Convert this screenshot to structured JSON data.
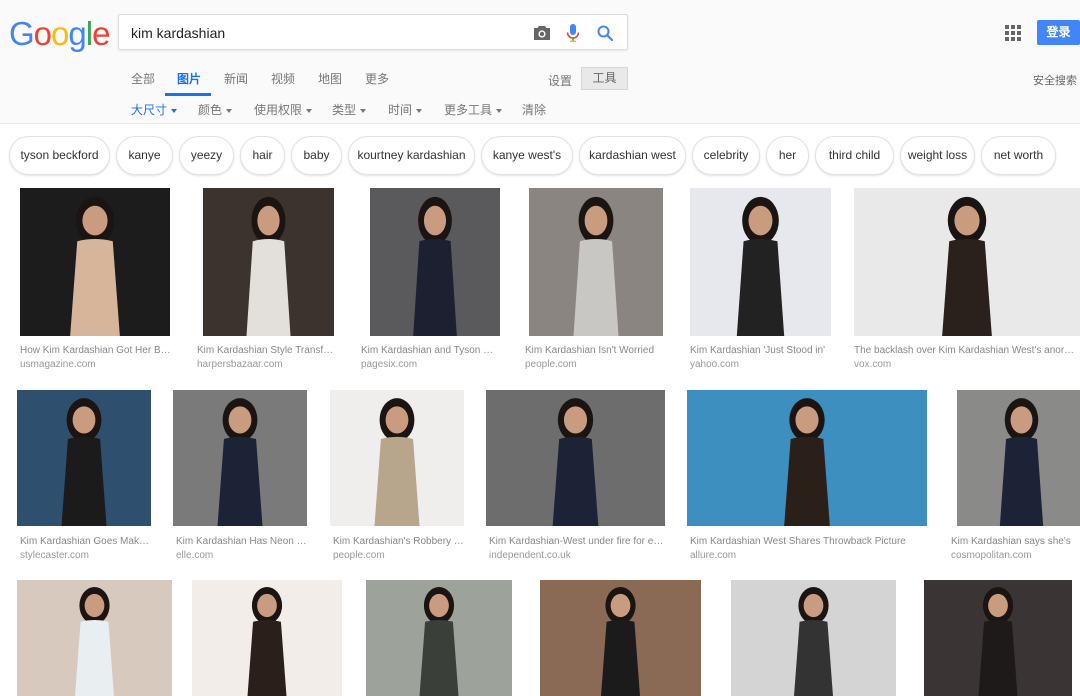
{
  "logo": {
    "text": "Google",
    "letters": [
      {
        "ch": "G",
        "color": "#4285f4"
      },
      {
        "ch": "o",
        "color": "#ea4335"
      },
      {
        "ch": "o",
        "color": "#fbbc05"
      },
      {
        "ch": "g",
        "color": "#4285f4"
      },
      {
        "ch": "l",
        "color": "#34a853"
      },
      {
        "ch": "e",
        "color": "#ea4335"
      }
    ]
  },
  "search": {
    "query": "kim kardashian",
    "camera_icon": "camera-icon",
    "mic_icon": "microphone-icon",
    "search_icon": "search-icon"
  },
  "header": {
    "apps_icon": "apps-grid-icon",
    "login_label": "登录",
    "settings_label": "设置",
    "tools_label": "工具",
    "safe_search_label": "安全搜索"
  },
  "tabs": [
    {
      "label": "全部",
      "active": false
    },
    {
      "label": "图片",
      "active": true
    },
    {
      "label": "新闻",
      "active": false
    },
    {
      "label": "视频",
      "active": false
    },
    {
      "label": "地图",
      "active": false
    },
    {
      "label": "更多",
      "active": false
    }
  ],
  "filters": [
    {
      "label": "大尺寸",
      "active": true,
      "dropdown": true
    },
    {
      "label": "颜色",
      "active": false,
      "dropdown": true
    },
    {
      "label": "使用权限",
      "active": false,
      "dropdown": true
    },
    {
      "label": "类型",
      "active": false,
      "dropdown": true
    },
    {
      "label": "时间",
      "active": false,
      "dropdown": true
    },
    {
      "label": "更多工具",
      "active": false,
      "dropdown": true
    },
    {
      "label": "清除",
      "active": false,
      "dropdown": false
    }
  ],
  "chips": [
    "tyson beckford",
    "kanye",
    "yeezy",
    "hair",
    "baby",
    "kourtney kardashian",
    "kanye west's",
    "kardashian west",
    "celebrity",
    "her",
    "third child",
    "weight loss",
    "net worth"
  ],
  "results": [
    {
      "title": "How Kim Kardashian Got Her Body Back",
      "source": "usmagazine.com",
      "bg": "#1c1c1c",
      "fg": "#d7b59a"
    },
    {
      "title": "Kim Kardashian Style Transformation",
      "source": "harpersbazaar.com",
      "bg": "#3b342e",
      "fg": "#e3e0dc"
    },
    {
      "title": "Kim Kardashian and Tyson Beckford",
      "source": "pagesix.com",
      "bg": "#5a5a5c",
      "fg": "#1d2030"
    },
    {
      "title": "Kim Kardashian Isn't Worried",
      "source": "people.com",
      "bg": "#8a8580",
      "fg": "#c9c7c4"
    },
    {
      "title": "Kim Kardashian 'Just Stood in'",
      "source": "yahoo.com",
      "bg": "#e6e8ee",
      "fg": "#222222"
    },
    {
      "title": "The backlash over Kim Kardashian West's anorexic photo",
      "source": "vox.com",
      "bg": "#e9e9e9",
      "fg": "#2a201c"
    },
    {
      "title": "Kim Kardashian Goes Makeup-Free",
      "source": "stylecaster.com",
      "bg": "#2f4f6f",
      "fg": "#1b1b1b"
    },
    {
      "title": "Kim Kardashian Has Neon Hair",
      "source": "elle.com",
      "bg": "#7a7a7a",
      "fg": "#1d2336"
    },
    {
      "title": "Kim Kardashian's Robbery Trial",
      "source": "people.com",
      "bg": "#efeeec",
      "fg": "#b8a68c"
    },
    {
      "title": "Kim Kardashian-West under fire for editing",
      "source": "independent.co.uk",
      "bg": "#6d6d6d",
      "fg": "#1d2336"
    },
    {
      "title": "Kim Kardashian West Shares Throwback Picture",
      "source": "allure.com",
      "bg": "#3d8fbf",
      "fg": "#2b1f1a"
    },
    {
      "title": "Kim Kardashian says she's",
      "source": "cosmopolitan.com",
      "bg": "#8a8a88",
      "fg": "#1d2336"
    },
    {
      "title": "",
      "source": "",
      "bg": "#d8c9bf",
      "fg": "#e9eef0"
    },
    {
      "title": "",
      "source": "",
      "bg": "#f3ede9",
      "fg": "#2a1f1b"
    },
    {
      "title": "",
      "source": "",
      "bg": "#9da29a",
      "fg": "#3a3f3a"
    },
    {
      "title": "",
      "source": "",
      "bg": "#8a6a55",
      "fg": "#1b1b1b"
    },
    {
      "title": "",
      "source": "",
      "bg": "#d4d4d4",
      "fg": "#333333"
    },
    {
      "title": "",
      "source": "",
      "bg": "#3a3434",
      "fg": "#1d1a19"
    }
  ]
}
